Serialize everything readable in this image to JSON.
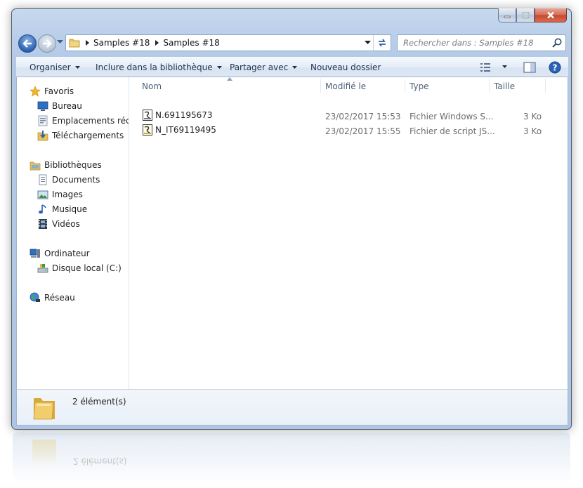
{
  "window": {
    "address": {
      "crumbs": [
        "Samples #18",
        "Samples #18"
      ]
    },
    "search": {
      "placeholder": "Rechercher dans : Samples #18"
    }
  },
  "toolbar": {
    "organize": "Organiser",
    "include_library": "Inclure dans la bibliothèque",
    "share_with": "Partager avec",
    "new_folder": "Nouveau dossier"
  },
  "sidebar": {
    "favorites": {
      "label": "Favoris",
      "items": [
        {
          "label": "Bureau",
          "icon": "desktop-icon"
        },
        {
          "label": "Emplacements récents",
          "icon": "recent-places-icon"
        },
        {
          "label": "Téléchargements",
          "icon": "downloads-icon"
        }
      ]
    },
    "libraries": {
      "label": "Bibliothèques",
      "items": [
        {
          "label": "Documents",
          "icon": "documents-icon"
        },
        {
          "label": "Images",
          "icon": "images-icon"
        },
        {
          "label": "Musique",
          "icon": "music-icon"
        },
        {
          "label": "Vidéos",
          "icon": "videos-icon"
        }
      ]
    },
    "computer": {
      "label": "Ordinateur",
      "items": [
        {
          "label": "Disque local (C:)",
          "icon": "local-disk-icon"
        }
      ]
    },
    "network": {
      "label": "Réseau"
    }
  },
  "file_list": {
    "columns": [
      "Nom",
      "Modifié le",
      "Type",
      "Taille"
    ],
    "rows": [
      {
        "name": "N.691195673",
        "modified": "23/02/2017 15:53",
        "type": "Fichier Windows S...",
        "size": "3 Ko"
      },
      {
        "name": "N_IT69119495",
        "modified": "23/02/2017 15:55",
        "type": "Fichier de script JS...",
        "size": "3 Ko"
      }
    ]
  },
  "details": {
    "count": "2 élément(s)"
  },
  "colors": {
    "window_frame": "#b9cee9",
    "command_bar": "#dce7f4",
    "close_button": "#c5472e"
  }
}
